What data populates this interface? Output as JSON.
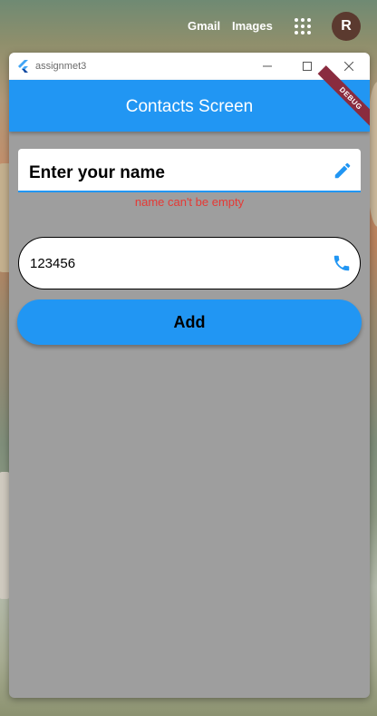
{
  "browser": {
    "gmail_label": "Gmail",
    "images_label": "Images",
    "avatar_letter": "R"
  },
  "window": {
    "title": "assignmet3"
  },
  "appbar": {
    "title": "Contacts Screen",
    "debug_banner": "DEBUG"
  },
  "form": {
    "name_field": {
      "placeholder": "Enter your name",
      "icon": "edit-icon"
    },
    "name_error": "name can't be empty",
    "phone_field": {
      "value": "123456",
      "icon": "phone-icon"
    },
    "add_button_label": "Add"
  },
  "colors": {
    "primary": "#2196f3",
    "background": "#9e9e9e",
    "error": "#e53935",
    "debug_banner": "#8a2c3f"
  }
}
